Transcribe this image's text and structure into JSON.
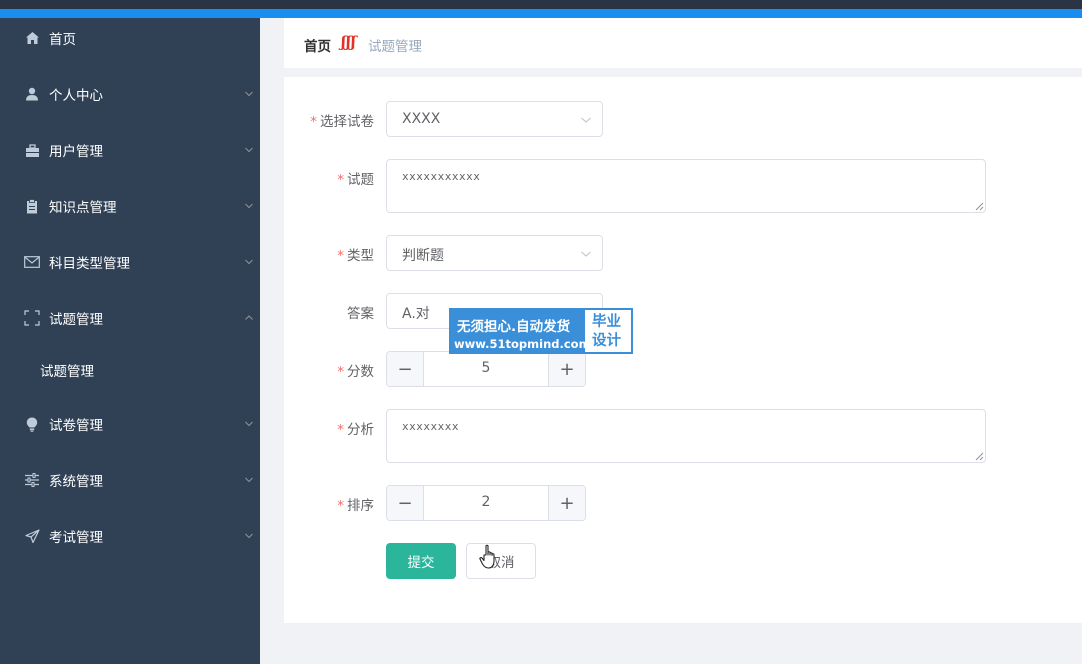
{
  "colors": {
    "sidebar": "#304156",
    "accent": "#1a8df0",
    "submit": "#2bb69c",
    "required": "#f56c6c"
  },
  "sidebar": {
    "items": [
      {
        "label": "首页",
        "icon": "home-icon"
      },
      {
        "label": "个人中心",
        "icon": "user-icon"
      },
      {
        "label": "用户管理",
        "icon": "briefcase-icon"
      },
      {
        "label": "知识点管理",
        "icon": "clipboard-icon"
      },
      {
        "label": "科目类型管理",
        "icon": "mail-icon"
      },
      {
        "label": "试题管理",
        "icon": "frame-icon",
        "expanded": true
      },
      {
        "label": "试卷管理",
        "icon": "lightbulb-icon"
      },
      {
        "label": "系统管理",
        "icon": "sliders-icon"
      },
      {
        "label": "考试管理",
        "icon": "send-icon"
      }
    ],
    "subitems": [
      {
        "label": "试题管理"
      }
    ]
  },
  "breadcrumb": {
    "home": "首页",
    "separator": "ʃʃʃ",
    "current": "试题管理"
  },
  "form": {
    "paper": {
      "label": "选择试卷",
      "value": "XXXX"
    },
    "question": {
      "label": "试题",
      "value": "xxxxxxxxxxx"
    },
    "type": {
      "label": "类型",
      "value": "判断题"
    },
    "answer": {
      "label": "答案",
      "value": "A.对"
    },
    "score": {
      "label": "分数",
      "value": "5"
    },
    "analysis": {
      "label": "分析",
      "value": "xxxxxxxx"
    },
    "order": {
      "label": "排序",
      "value": "2"
    },
    "required_mark": "*",
    "minus": "−",
    "plus": "+",
    "submit_label": "提交",
    "cancel_label": "取消"
  },
  "watermark": {
    "line1": "无须担心.自动发货",
    "line2": "www.51topmind.com",
    "side": "毕业设计"
  }
}
